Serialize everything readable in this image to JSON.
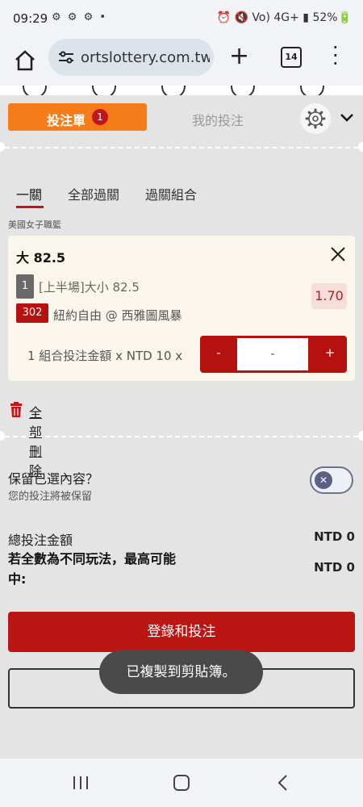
{
  "status_bar": {
    "time": "09:29",
    "icons": "⚙ ⚙ ⚙ •",
    "right": "⏰ 🔇 Vo) 4G+ ▮ 52%🔋"
  },
  "browser": {
    "url": "ortslottery.com.tw",
    "tab_count": "14"
  },
  "slip_header": {
    "bet_slip_label": "投注單",
    "bet_count": "1",
    "my_bets_label": "我的投注"
  },
  "bet_types": [
    {
      "label": "一關",
      "active": true
    },
    {
      "label": "全部過關",
      "active": false
    },
    {
      "label": "過關組合",
      "active": false
    }
  ],
  "league": "美國女子職籃",
  "bet": {
    "selection": "大 82.5",
    "leg_no": "1",
    "market": "[上半場]大小 82.5",
    "odds": "1.70",
    "match_code": "302",
    "match": "紐約自由 @ 西雅圖風暴",
    "stake_label": "1 組合投注金額 x NTD 10 x",
    "stake_minus": "-",
    "stake_value": "-",
    "stake_plus": "+"
  },
  "delete_all_label": "全部刪除",
  "keep": {
    "question": "保留已選內容？",
    "sub": "您的投注將被保留"
  },
  "totals": {
    "total_label": "總投注金額",
    "total_value": "NTD 0",
    "max_win_label": "若全數為不同玩法，最高可能中:",
    "max_win_value": "NTD 0"
  },
  "buttons": {
    "login_bet": "登錄和投注",
    "get_code": "獲取投注代碼"
  },
  "toast": "已複製到剪貼簿。",
  "colors": {
    "accent_orange": "#f47d1a",
    "brand_red": "#b91614",
    "background": "#e4e4e4"
  }
}
